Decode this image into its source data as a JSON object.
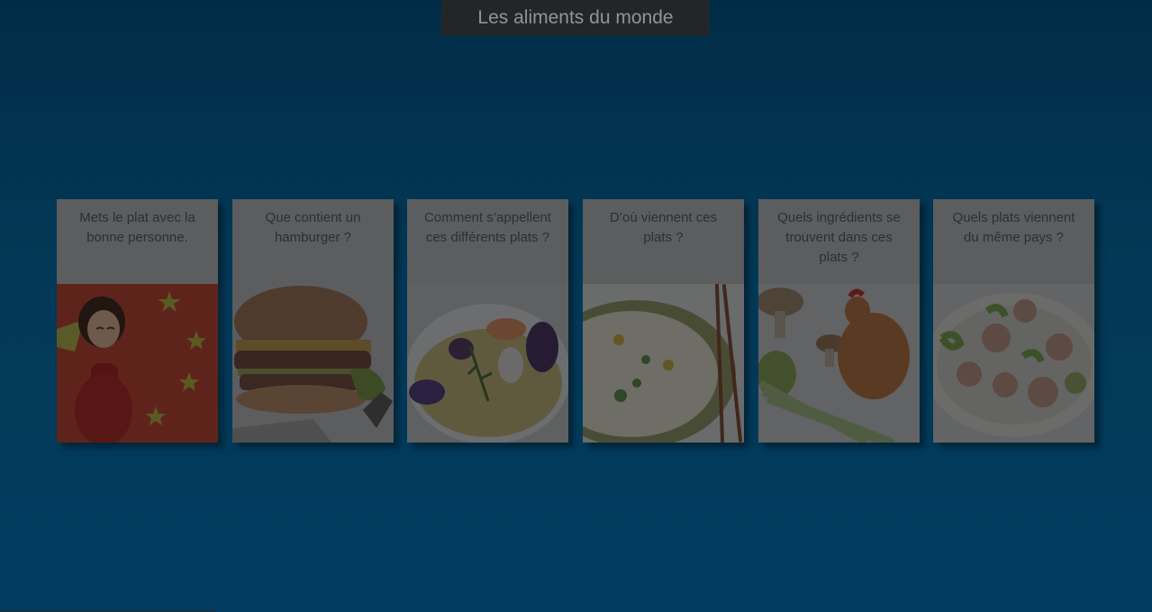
{
  "header": {
    "title": "Les aliments du monde"
  },
  "cards": [
    {
      "caption": "Mets le plat avec la bonne personne.",
      "image_icon": "chinese-girl-flag-illustration"
    },
    {
      "caption": "Que contient un hamburger ?",
      "image_icon": "hamburger-illustration"
    },
    {
      "caption": "Comment s’appellent ces différents plats ?",
      "image_icon": "seafood-dish-illustration"
    },
    {
      "caption": "D’où viennent ces plats ?",
      "image_icon": "rice-plate-chopsticks-illustration"
    },
    {
      "caption": "Quels ingrédients se trouvent dans ces plats ?",
      "image_icon": "chicken-mushrooms-leek-illustration"
    },
    {
      "caption": "Quels plats viennent du même pays ?",
      "image_icon": "escargots-plate-illustration"
    }
  ],
  "colors": {
    "background": "#033957",
    "title_bar": "#232629",
    "caption_bg": "#5b5d5f",
    "caption_text": "#2d2f31"
  }
}
